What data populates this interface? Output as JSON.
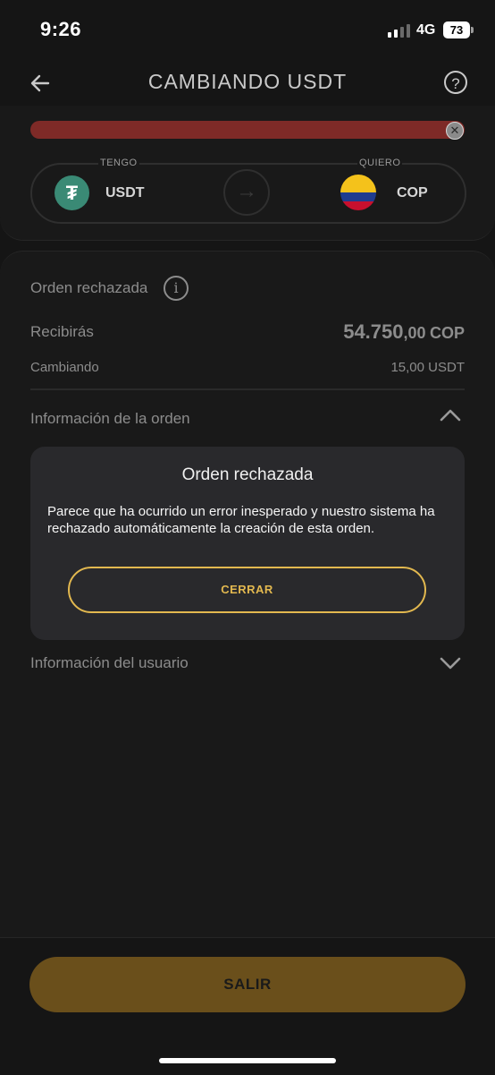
{
  "status_bar": {
    "time": "9:26",
    "network": "4G",
    "battery": "73"
  },
  "header": {
    "back_icon": "arrow-left-icon",
    "title": "CAMBIANDO USDT",
    "help_icon": "question-circle-icon",
    "help_glyph": "?"
  },
  "progress": {
    "fill_fraction": 1.0,
    "color": "#7e2a27",
    "close_glyph": "✕"
  },
  "pair": {
    "from_label": "TENGO",
    "from_code": "USDT",
    "from_icon": "tether-icon",
    "from_glyph": "₮",
    "swap_icon": "arrow-right-icon",
    "swap_glyph": "→",
    "to_label": "QUIERO",
    "to_code": "COP",
    "to_icon": "colombia-flag-icon"
  },
  "summary": {
    "status_label": "Orden rechazada",
    "info_glyph": "i",
    "receive_label": "Recibirás",
    "receive_amount_int": "54.750",
    "receive_amount_dec": ",00",
    "receive_currency": "COP",
    "sending_label": "Cambiando",
    "sending_amount": "15,00 USDT"
  },
  "sections": {
    "order_info": "Información de la orden",
    "user_info": "Información del usuario"
  },
  "modal": {
    "title": "Orden rechazada",
    "message": "Parece que ha ocurrido un error inesperado y nuestro sistema ha rechazado automáticamente la creación de esta orden.",
    "close_label": "CERRAR"
  },
  "footer": {
    "exit_label": "SALIR"
  },
  "colors": {
    "accent": "#e2b84f",
    "exit_button": "#6a4f1b",
    "error": "#7e2a27",
    "background": "#151515"
  }
}
